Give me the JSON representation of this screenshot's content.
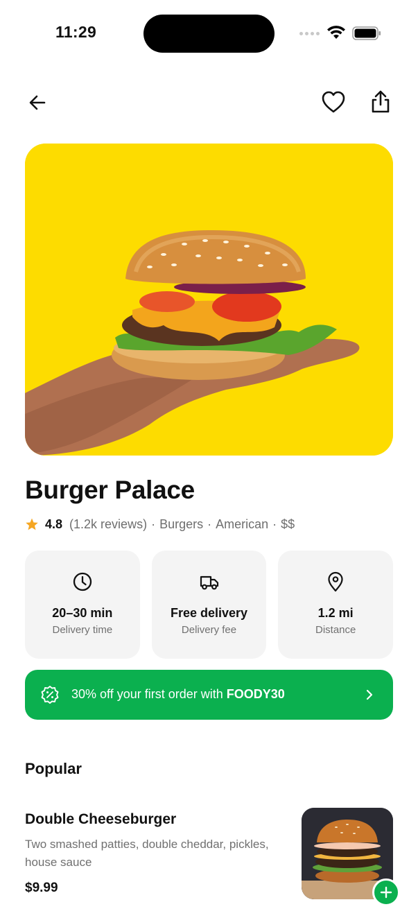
{
  "status_bar": {
    "time": "11:29"
  },
  "nav": {
    "back_icon": "arrow-left-icon",
    "favorite_icon": "heart-icon",
    "share_icon": "share-icon"
  },
  "restaurant": {
    "name": "Burger Palace",
    "rating": "4.8",
    "reviews": "(1.2k reviews)",
    "tags": [
      "Burgers",
      "American",
      "$$"
    ],
    "separator": "·"
  },
  "info_cards": [
    {
      "icon": "clock-icon",
      "value": "20–30 min",
      "label": "Delivery time"
    },
    {
      "icon": "truck-icon",
      "value": "Free delivery",
      "label": "Delivery fee"
    },
    {
      "icon": "location-pin-icon",
      "value": "1.2 mi",
      "label": "Distance"
    }
  ],
  "promo": {
    "icon": "discount-badge-icon",
    "text": "30% off your first order with ",
    "code": "FOODY30",
    "chevron_icon": "chevron-right-icon"
  },
  "popular": {
    "title": "Popular",
    "items": [
      {
        "name": "Double Cheeseburger",
        "description": "Two smashed patties, double cheddar, pickles, house sauce",
        "price": "$9.99",
        "add_icon": "plus-icon"
      }
    ]
  },
  "colors": {
    "accent_green": "#0bb04f",
    "hero_yellow": "#fddc00",
    "star": "#f5a623",
    "card_bg": "#f4f4f4"
  }
}
